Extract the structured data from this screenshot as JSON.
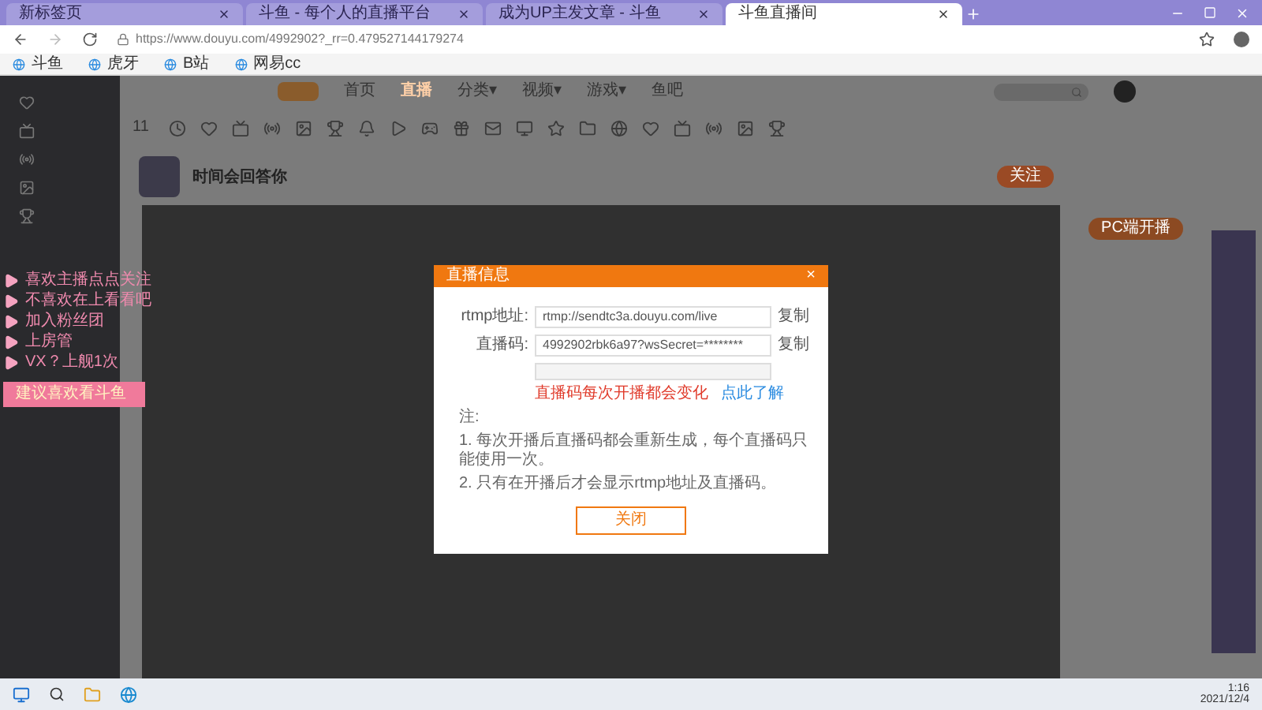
{
  "browser": {
    "tabs": [
      {
        "title": "新标签页",
        "selected": false
      },
      {
        "title": "斗鱼 - 每个人的直播平台",
        "selected": false
      },
      {
        "title": "成为UP主发文章 - 斗鱼",
        "selected": false
      },
      {
        "title": "斗鱼直播间",
        "selected": true
      }
    ],
    "url": "https://www.douyu.com/4992902?_rr=0.479527144179274",
    "bookmarks": [
      "斗鱼",
      "虎牙",
      "B站",
      "网易cc"
    ]
  },
  "sidebar": {
    "overlay_lines": [
      "喜欢主播点点关注",
      "不喜欢在上看看吧",
      "加入粉丝团",
      "上房管",
      "VX？上舰1次"
    ],
    "banner": "建议喜欢看斗鱼"
  },
  "nav": {
    "items": [
      {
        "label": "首页",
        "selected": false
      },
      {
        "label": "直播",
        "selected": true
      },
      {
        "label": "分类▾",
        "selected": false
      },
      {
        "label": "视频▾",
        "selected": false
      },
      {
        "label": "游戏▾",
        "selected": false
      },
      {
        "label": "鱼吧",
        "selected": false
      }
    ],
    "day_count": "11"
  },
  "streamer": {
    "name": "时间会回答你",
    "follow": "关注"
  },
  "right_panel": {
    "start_button": "PC端开播"
  },
  "dialog": {
    "title": "直播信息",
    "close": "×",
    "fields": [
      {
        "label": "rtmp地址:",
        "value": "rtmp://sendtc3a.douyu.com/live",
        "action": "复制"
      },
      {
        "label": "直播码:",
        "value": "4992902rbk6a97?wsSecret=********",
        "action": "复制"
      }
    ],
    "warning": "直播码每次开播都会变化",
    "link": "点此了解",
    "notes": [
      "注:",
      "1. 每次开播后直播码都会重新生成，每个直播码只能使用一次。",
      "2. 只有在开播后才会显示rtmp地址及直播码。"
    ],
    "button": "关闭"
  },
  "taskbar": {
    "time": "1:16",
    "date": "2021/12/4"
  }
}
